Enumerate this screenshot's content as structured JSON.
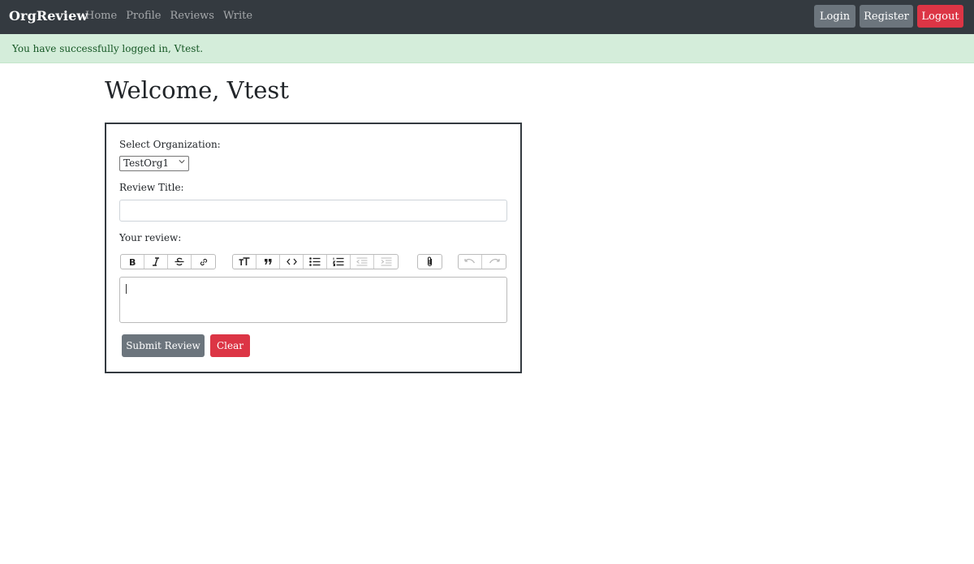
{
  "navbar": {
    "brand": "OrgReview",
    "links": [
      "Home",
      "Profile",
      "Reviews",
      "Write"
    ],
    "login_label": "Login",
    "register_label": "Register",
    "logout_label": "Logout"
  },
  "alert": {
    "message": "You have successfully logged in, Vtest."
  },
  "page": {
    "heading": "Welcome, Vtest"
  },
  "form": {
    "org_label": "Select Organization:",
    "org_selected": "TestOrg1",
    "title_label": "Review Title:",
    "title_value": "",
    "review_label": "Your review:",
    "review_value": "",
    "toolbar": {
      "formatting": [
        "bold-icon",
        "italic-icon",
        "strikethrough-icon",
        "link-icon"
      ],
      "blocks": [
        "heading-icon",
        "quote-icon",
        "code-icon",
        "bullet-list-icon",
        "numbered-list-icon",
        "decrease-indent-icon",
        "increase-indent-icon"
      ],
      "files": [
        "attach-icon"
      ],
      "history": [
        "undo-icon",
        "redo-icon"
      ]
    },
    "submit_label": "Submit Review",
    "clear_label": "Clear"
  },
  "colors": {
    "navbar_bg": "#343a40",
    "alert_bg": "#d4edda",
    "alert_text": "#155724",
    "secondary": "#6c757d",
    "danger": "#dc3545"
  }
}
